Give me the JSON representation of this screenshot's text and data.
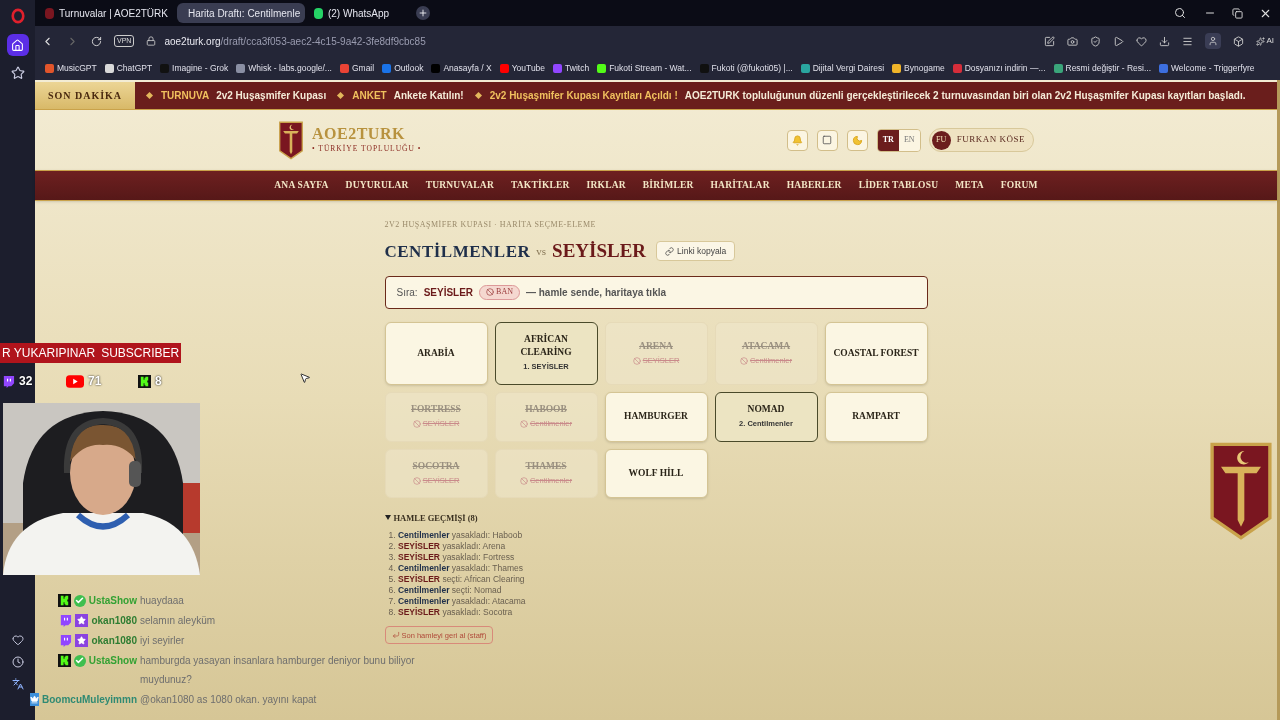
{
  "browser": {
    "tabs": [
      {
        "title": "Turnuvalar | AOE2TÜRK",
        "selected": false
      },
      {
        "title": "Harita Draftı: Centilmenle",
        "selected": true
      },
      {
        "title": "(2) WhatsApp",
        "selected": false
      }
    ],
    "vpn_label": "VPN",
    "url_host": "aoe2turk.org",
    "url_path": "/draft/cca3f053-aec2-4c15-9a42-3fe8df9cbc85",
    "ai_label": "AI",
    "bookmarks": [
      {
        "title": "MusicGPT",
        "color": "#e2552b"
      },
      {
        "title": "ChatGPT",
        "color": "#d9d9d9"
      },
      {
        "title": "Imagine - Grok",
        "color": "#111111"
      },
      {
        "title": "Whisk - labs.google/...",
        "color": "#8a8fa3"
      },
      {
        "title": "Gmail",
        "color": "#ea4335"
      },
      {
        "title": "Outlook",
        "color": "#1a73e8"
      },
      {
        "title": "Anasayfa / X",
        "color": "#000000"
      },
      {
        "title": "YouTube",
        "color": "#ff0000"
      },
      {
        "title": "Twitch",
        "color": "#9146ff"
      },
      {
        "title": "Fukoti Stream - Wat...",
        "color": "#53fc18"
      },
      {
        "title": "Fukoti (@fukoti05) |...",
        "color": "#101010"
      },
      {
        "title": "Dijital Vergi Dairesi",
        "color": "#2aa6a0"
      },
      {
        "title": "Bynogame",
        "color": "#f0b429"
      },
      {
        "title": "Dosyanızı indirin —...",
        "color": "#d62d3a"
      },
      {
        "title": "Resmi değiştir - Resi...",
        "color": "#3aa57a"
      },
      {
        "title": "Welcome - Triggerfyre",
        "color": "#3d6fe0"
      }
    ]
  },
  "ticker": {
    "label": "SON DAKİKA",
    "items": [
      {
        "tag": "TURNUVA",
        "text": "2v2 Huşaşmifer Kupası"
      },
      {
        "tag": "ANKET",
        "text": "Ankete Katılın!"
      },
      {
        "tag": "2v2 Huşaşmifer Kupası Kayıtları Açıldı !",
        "text": "AOE2TURK topluluğunun düzenli gerçekleştirilecek 2 turnuvasından biri olan 2v2 Huşaşmifer Kupası kayıtları başladı."
      }
    ]
  },
  "header": {
    "site_title": "AOE2TURK",
    "site_subtitle": "• TÜRKİYE TOPLULUĞU •",
    "languages": [
      {
        "code": "TR",
        "selected": true
      },
      {
        "code": "EN",
        "selected": false
      }
    ],
    "user_initials": "FU",
    "user_name": "FURKAN KÖSE"
  },
  "nav": [
    "ANA SAYFA",
    "DUYURULAR",
    "TURNUVALAR",
    "TAKTİKLER",
    "IRKLAR",
    "BİRİMLER",
    "HARİTALAR",
    "HABERLER",
    "LİDER TABLOSU",
    "META",
    "FORUM"
  ],
  "draft": {
    "breadcrumb": "2V2 HUŞAŞMİFER KUPASI · HARİTA SEÇME-ELEME",
    "home_team": "CENTİLMENLER",
    "versus": "vs",
    "away_team": "SEYİSLER",
    "copy_link": "Linki kopyala",
    "turn": {
      "label": "Sıra:",
      "team": "SEYİSLER",
      "action": "BAN",
      "message": "— hamle sende, haritaya tıkla"
    },
    "maps": [
      {
        "name": "ARABİA",
        "kind": "open"
      },
      {
        "name": "AFRİCAN CLEARİNG",
        "kind": "picked",
        "note": "1. SEYİSLER"
      },
      {
        "name": "ARENA",
        "kind": "banned",
        "note": "SEYİSLER"
      },
      {
        "name": "ATACAMA",
        "kind": "banned",
        "note": "Centilmenler"
      },
      {
        "name": "COASTAL FOREST",
        "kind": "open"
      },
      {
        "name": "FORTRESS",
        "kind": "banned",
        "note": "SEYİSLER"
      },
      {
        "name": "HABOOB",
        "kind": "banned",
        "note": "Centilmenler"
      },
      {
        "name": "HAMBURGER",
        "kind": "open"
      },
      {
        "name": "NOMAD",
        "kind": "picked",
        "note": "2. Centilmenler"
      },
      {
        "name": "RAMPART",
        "kind": "open"
      },
      {
        "name": "SOCOTRA",
        "kind": "banned",
        "note": "SEYİSLER"
      },
      {
        "name": "THAMES",
        "kind": "banned",
        "note": "Centilmenler"
      },
      {
        "name": "WOLF HİLL",
        "kind": "open"
      }
    ],
    "history_title": "HAMLE GEÇMİŞİ (8)",
    "history_expanded": true,
    "history": [
      {
        "number": "1.",
        "team": "Centilmenler",
        "color": "#1f2f4a",
        "action": "yasakladı: Haboob"
      },
      {
        "number": "2.",
        "team": "SEYİSLER",
        "color": "#6b1a1a",
        "action": "yasakladı: Arena"
      },
      {
        "number": "3.",
        "team": "SEYİSLER",
        "color": "#6b1a1a",
        "action": "yasakladı: Fortress"
      },
      {
        "number": "4.",
        "team": "Centilmenler",
        "color": "#1f2f4a",
        "action": "yasakladı: Thames"
      },
      {
        "number": "5.",
        "team": "SEYİSLER",
        "color": "#6b1a1a",
        "action": "seçti: African Clearing"
      },
      {
        "number": "6.",
        "team": "Centilmenler",
        "color": "#1f2f4a",
        "action": "seçti: Nomad"
      },
      {
        "number": "7.",
        "team": "Centilmenler",
        "color": "#1f2f4a",
        "action": "yasakladı: Atacama"
      },
      {
        "number": "8.",
        "team": "SEYİSLER",
        "color": "#6b1a1a",
        "action": "yasakladı: Socotra"
      }
    ],
    "undo": "Son hamleyi geri al (staff)"
  },
  "stream": {
    "banner_name": "R YUKARIPINAR",
    "banner_label": "SUBSCRIBER",
    "counts": [
      {
        "kind": "twitch",
        "count": "32"
      },
      {
        "kind": "youtube",
        "count": "71"
      },
      {
        "kind": "kick",
        "count": "8"
      }
    ],
    "chat": [
      {
        "kind": "kick",
        "user": "UstaShow",
        "color": "#33a133",
        "message": "huaydaaa"
      },
      {
        "kind": "twitch",
        "user": "okan1080",
        "color": "#2e7d32",
        "message": "selamın aleyküm"
      },
      {
        "kind": "twitch",
        "user": "okan1080",
        "color": "#2e7d32",
        "message": "iyi seyirler"
      },
      {
        "kind": "kick",
        "user": "UstaShow",
        "color": "#33a133",
        "message": "hamburgda yasayan insanlara hamburger deniyor bunu biliyor muydunuz?"
      },
      {
        "kind": "other",
        "user": "BoomcuMuleyimmn",
        "color": "#2f8a73",
        "message": "@okan1080 as 1080 okan. yayını kapat"
      }
    ]
  }
}
